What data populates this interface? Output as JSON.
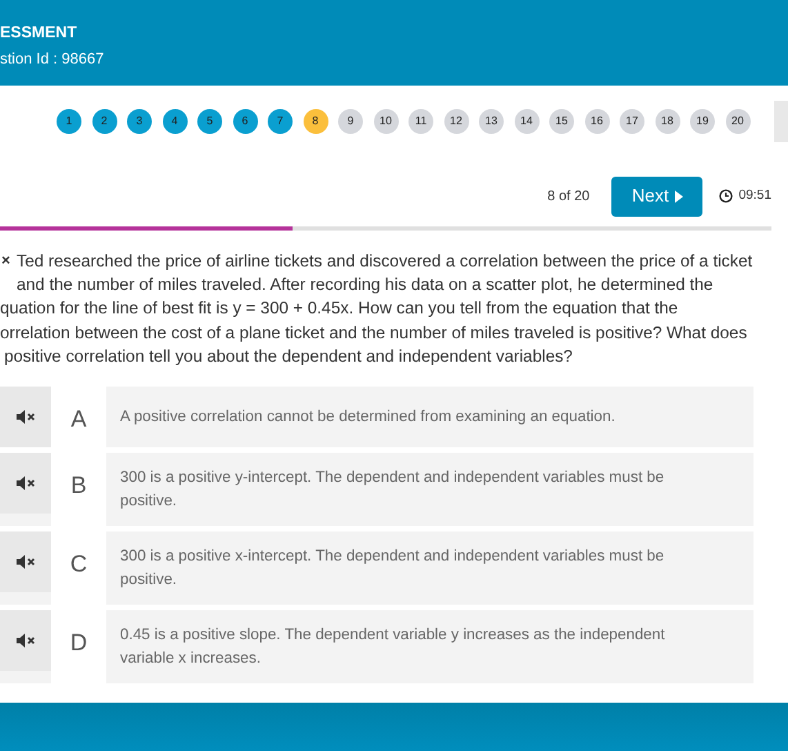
{
  "header": {
    "title": "ESSMENT",
    "question_id": "stion Id : 98667"
  },
  "navigator": [
    {
      "label": "1",
      "answered": true,
      "selected": false
    },
    {
      "label": "2",
      "answered": true,
      "selected": false
    },
    {
      "label": "3",
      "answered": true,
      "selected": false
    },
    {
      "label": "4",
      "answered": true,
      "selected": false
    },
    {
      "label": "5",
      "answered": true,
      "selected": false
    },
    {
      "label": "6",
      "answered": true,
      "selected": false
    },
    {
      "label": "7",
      "answered": true,
      "selected": false
    },
    {
      "label": "8",
      "answered": false,
      "selected": true
    },
    {
      "label": "9",
      "answered": false,
      "selected": false
    },
    {
      "label": "10",
      "answered": false,
      "selected": false
    },
    {
      "label": "11",
      "answered": false,
      "selected": false
    },
    {
      "label": "12",
      "answered": false,
      "selected": false
    },
    {
      "label": "13",
      "answered": false,
      "selected": false
    },
    {
      "label": "14",
      "answered": false,
      "selected": false
    },
    {
      "label": "15",
      "answered": false,
      "selected": false
    },
    {
      "label": "16",
      "answered": false,
      "selected": false
    },
    {
      "label": "17",
      "answered": false,
      "selected": false
    },
    {
      "label": "18",
      "answered": false,
      "selected": false
    },
    {
      "label": "19",
      "answered": false,
      "selected": false
    },
    {
      "label": "20",
      "answered": false,
      "selected": false
    }
  ],
  "counter": "8 of 20",
  "next_button": "Next",
  "timer": "09:51",
  "progress": {
    "level": 0.38
  },
  "question": {
    "marker": "×",
    "lines": [
      "Ted researched the price of airline tickets and discovered a correlation between the price of a ticket",
      "and the number of miles traveled. After recording his data on a scatter plot, he determined the",
      "quation for the line of best fit is y = 300 + 0.45x. How can you tell from the equation that the",
      "orrelation between the cost of a plane ticket and the number of miles traveled is positive? What does",
      "positive correlation tell you about the dependent and independent variables?"
    ]
  },
  "options": [
    {
      "letter": "A",
      "text": "A positive correlation cannot be determined from examining an equation."
    },
    {
      "letter": "B",
      "text": "300 is a positive y-intercept. The dependent and independent variables must be positive."
    },
    {
      "letter": "C",
      "text": "300 is a positive x-intercept. The dependent and independent variables must be positive."
    },
    {
      "letter": "D",
      "text": "0.45 is a positive slope. The dependent variable y increases as the independent variable x increases."
    }
  ]
}
